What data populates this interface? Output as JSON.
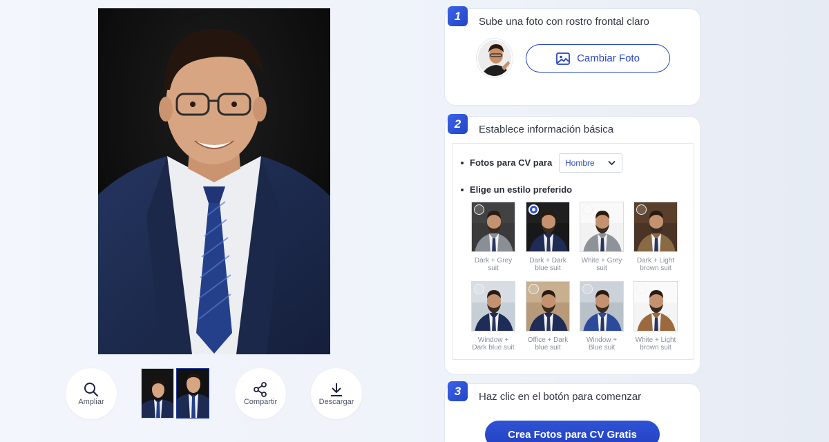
{
  "toolbar": {
    "zoom_label": "Ampliar",
    "share_label": "Compartir",
    "download_label": "Descargar"
  },
  "steps": [
    {
      "number": "1",
      "title": "Sube una foto con rostro frontal claro",
      "button_label": "Cambiar Foto"
    },
    {
      "number": "2",
      "title": "Establece información básica",
      "gender_label": "Fotos para CV para",
      "gender_value": "Hombre",
      "style_label": "Elige un estilo preferido"
    },
    {
      "number": "3",
      "title": "Haz clic en el botón para comenzar",
      "button_label": "Crea Fotos para CV Gratis"
    }
  ],
  "styles": [
    {
      "label": "Dark + Grey suit",
      "selected": false,
      "bg": "#3a3a3a",
      "suit": "#8a8e95",
      "bg2": "#4a4a4a"
    },
    {
      "label": "Dark + Dark blue suit",
      "selected": true,
      "bg": "#181818",
      "suit": "#1d2b55",
      "bg2": "#262626"
    },
    {
      "label": "White + Grey suit",
      "selected": false,
      "bg": "#f2f2f2",
      "suit": "#8e9299",
      "bg2": "#ffffff"
    },
    {
      "label": "Dark + Light brown suit",
      "selected": false,
      "bg": "#4a3426",
      "suit": "#8a6a44",
      "bg2": "#6a4a32"
    },
    {
      "label": "Window + Dark blue suit",
      "selected": false,
      "bg": "#c7cfd6",
      "suit": "#1e2c57",
      "bg2": "#e7ecf0"
    },
    {
      "label": "Office + Dark blue suit",
      "selected": false,
      "bg": "#b79a7a",
      "suit": "#1e2c57",
      "bg2": "#d8c3a6"
    },
    {
      "label": "Window + Blue suit",
      "selected": false,
      "bg": "#b8c0c8",
      "suit": "#2b4a9c",
      "bg2": "#dde3ea"
    },
    {
      "label": "White + Light brown suit",
      "selected": false,
      "bg": "#f4f4f4",
      "suit": "#9a6a3e",
      "bg2": "#ffffff"
    }
  ],
  "colors": {
    "accent": "#2845c2",
    "badge": "#2f54d8"
  }
}
